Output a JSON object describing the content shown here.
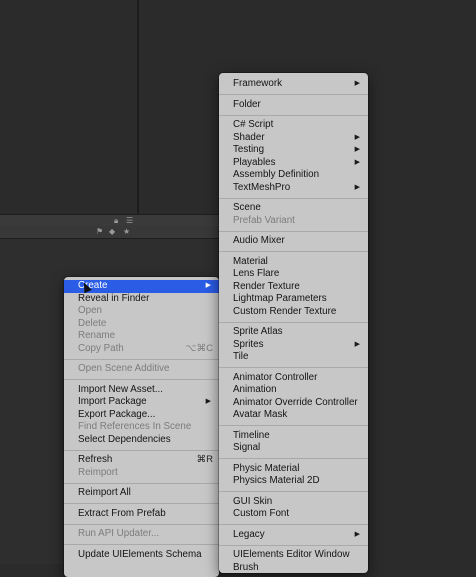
{
  "context_menu": {
    "items": [
      {
        "label": "Create",
        "submenu": true,
        "selected": true
      },
      {
        "label": "Reveal in Finder"
      },
      {
        "label": "Open",
        "disabled": true
      },
      {
        "label": "Delete",
        "disabled": true
      },
      {
        "label": "Rename",
        "disabled": true
      },
      {
        "label": "Copy Path",
        "disabled": true,
        "shortcut": "⌥⌘C"
      },
      {
        "separator": true
      },
      {
        "label": "Open Scene Additive",
        "disabled": true
      },
      {
        "separator": true
      },
      {
        "label": "Import New Asset..."
      },
      {
        "label": "Import Package",
        "submenu": true
      },
      {
        "label": "Export Package..."
      },
      {
        "label": "Find References In Scene",
        "disabled": true
      },
      {
        "label": "Select Dependencies"
      },
      {
        "separator": true
      },
      {
        "label": "Refresh",
        "shortcut": "⌘R"
      },
      {
        "label": "Reimport",
        "disabled": true
      },
      {
        "separator": true
      },
      {
        "label": "Reimport All"
      },
      {
        "separator": true
      },
      {
        "label": "Extract From Prefab"
      },
      {
        "separator": true
      },
      {
        "label": "Run API Updater...",
        "disabled": true
      },
      {
        "separator": true
      },
      {
        "label": "Update UIElements Schema"
      }
    ]
  },
  "create_submenu": {
    "items": [
      {
        "label": "Framework",
        "submenu": true
      },
      {
        "separator": true
      },
      {
        "label": "Folder"
      },
      {
        "separator": true
      },
      {
        "label": "C# Script"
      },
      {
        "label": "Shader",
        "submenu": true
      },
      {
        "label": "Testing",
        "submenu": true
      },
      {
        "label": "Playables",
        "submenu": true
      },
      {
        "label": "Assembly Definition"
      },
      {
        "label": "TextMeshPro",
        "submenu": true
      },
      {
        "separator": true
      },
      {
        "label": "Scene"
      },
      {
        "label": "Prefab Variant",
        "disabled": true
      },
      {
        "separator": true
      },
      {
        "label": "Audio Mixer"
      },
      {
        "separator": true
      },
      {
        "label": "Material"
      },
      {
        "label": "Lens Flare"
      },
      {
        "label": "Render Texture"
      },
      {
        "label": "Lightmap Parameters"
      },
      {
        "label": "Custom Render Texture"
      },
      {
        "separator": true
      },
      {
        "label": "Sprite Atlas"
      },
      {
        "label": "Sprites",
        "submenu": true
      },
      {
        "label": "Tile"
      },
      {
        "separator": true
      },
      {
        "label": "Animator Controller"
      },
      {
        "label": "Animation"
      },
      {
        "label": "Animator Override Controller"
      },
      {
        "label": "Avatar Mask"
      },
      {
        "separator": true
      },
      {
        "label": "Timeline"
      },
      {
        "label": "Signal"
      },
      {
        "separator": true
      },
      {
        "label": "Physic Material"
      },
      {
        "label": "Physics Material 2D"
      },
      {
        "separator": true
      },
      {
        "label": "GUI Skin"
      },
      {
        "label": "Custom Font"
      },
      {
        "separator": true
      },
      {
        "label": "Legacy",
        "submenu": true
      },
      {
        "separator": true
      },
      {
        "label": "UIElements Editor Window"
      },
      {
        "label": "Brush"
      }
    ]
  },
  "icons": {
    "submenu_arrow": "▶",
    "header_icons": [
      "lock-icon",
      "menu-icon",
      "tag-icon",
      "label-icon",
      "star-icon"
    ]
  },
  "colors": {
    "menu_bg": "#c7c7c7",
    "selection": "#2b5ce6",
    "editor_bg": "#2b2b2b"
  }
}
